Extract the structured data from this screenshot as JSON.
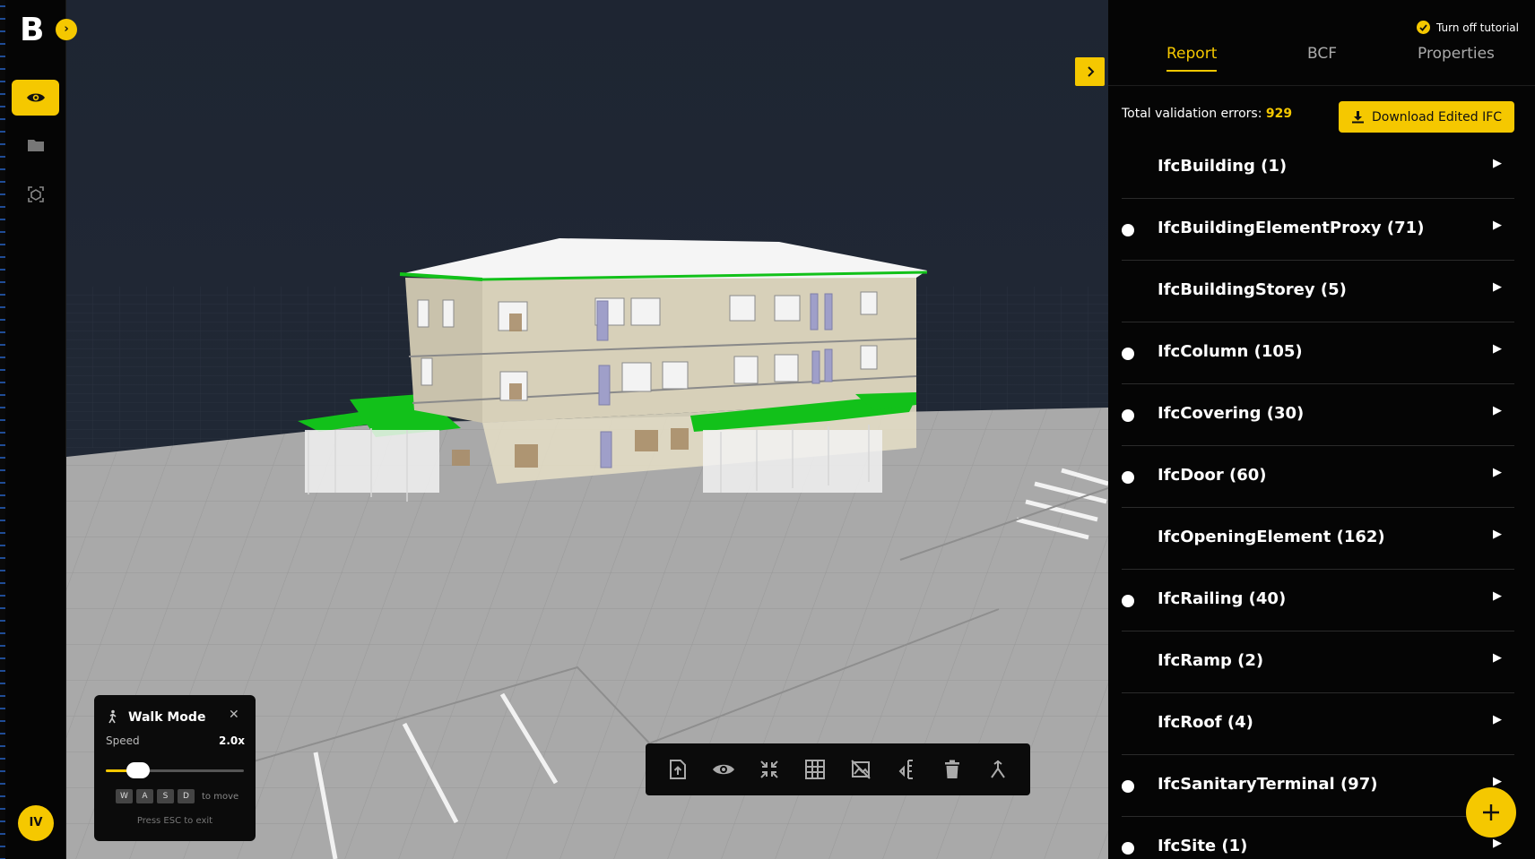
{
  "sidebar": {
    "logo": "B",
    "expand_icon": "chevron-right-icon",
    "items": [
      {
        "name": "visibility",
        "icon": "eye-icon",
        "active": true
      },
      {
        "name": "files",
        "icon": "folder-icon",
        "active": false
      },
      {
        "name": "model-tree",
        "icon": "cube-scan-icon",
        "active": false
      }
    ],
    "user_initials": "IV"
  },
  "viewport": {
    "collapse_icon": "chevron-right-icon",
    "walk_mode": {
      "title": "Walk Mode",
      "speed_label": "Speed",
      "speed_value": "2.0x",
      "speed_fraction": 0.15,
      "keys": [
        "W",
        "A",
        "S",
        "D"
      ],
      "keys_hint": "to move",
      "esc_hint": "Press ESC to exit"
    },
    "toolbar": [
      {
        "name": "upload-file",
        "icon": "file-upload-icon"
      },
      {
        "name": "visibility",
        "icon": "eye-icon"
      },
      {
        "name": "fit-view",
        "icon": "collapse-arrows-icon"
      },
      {
        "name": "grid",
        "icon": "grid-icon"
      },
      {
        "name": "hide-selection",
        "icon": "hide-image-icon"
      },
      {
        "name": "measure",
        "icon": "measure-icon"
      },
      {
        "name": "delete",
        "icon": "trash-icon"
      },
      {
        "name": "walk",
        "icon": "walk-icon"
      }
    ]
  },
  "panel": {
    "tutorial_label": "Turn off tutorial",
    "tabs": [
      {
        "label": "Report",
        "active": true
      },
      {
        "label": "BCF",
        "active": false
      },
      {
        "label": "Properties",
        "active": false
      }
    ],
    "summary_label": "Total validation errors:",
    "summary_value": "929",
    "download_label": "Download Edited IFC",
    "items": [
      {
        "label": "IfcBuilding (1)",
        "dot": false
      },
      {
        "label": "IfcBuildingElementProxy (71)",
        "dot": true
      },
      {
        "label": "IfcBuildingStorey (5)",
        "dot": false
      },
      {
        "label": "IfcColumn (105)",
        "dot": true
      },
      {
        "label": "IfcCovering (30)",
        "dot": true
      },
      {
        "label": "IfcDoor (60)",
        "dot": true
      },
      {
        "label": "IfcOpeningElement (162)",
        "dot": false
      },
      {
        "label": "IfcRailing (40)",
        "dot": true
      },
      {
        "label": "IfcRamp (2)",
        "dot": false
      },
      {
        "label": "IfcRoof (4)",
        "dot": false
      },
      {
        "label": "IfcSanitaryTerminal (97)",
        "dot": true
      },
      {
        "label": "IfcSite (1)",
        "dot": true
      }
    ]
  },
  "colors": {
    "accent": "#f5c800",
    "panel_bg": "#050505",
    "sky": "#1f2633",
    "ground": "#a9a9a9",
    "roof_trim": "#0fbf1a"
  }
}
